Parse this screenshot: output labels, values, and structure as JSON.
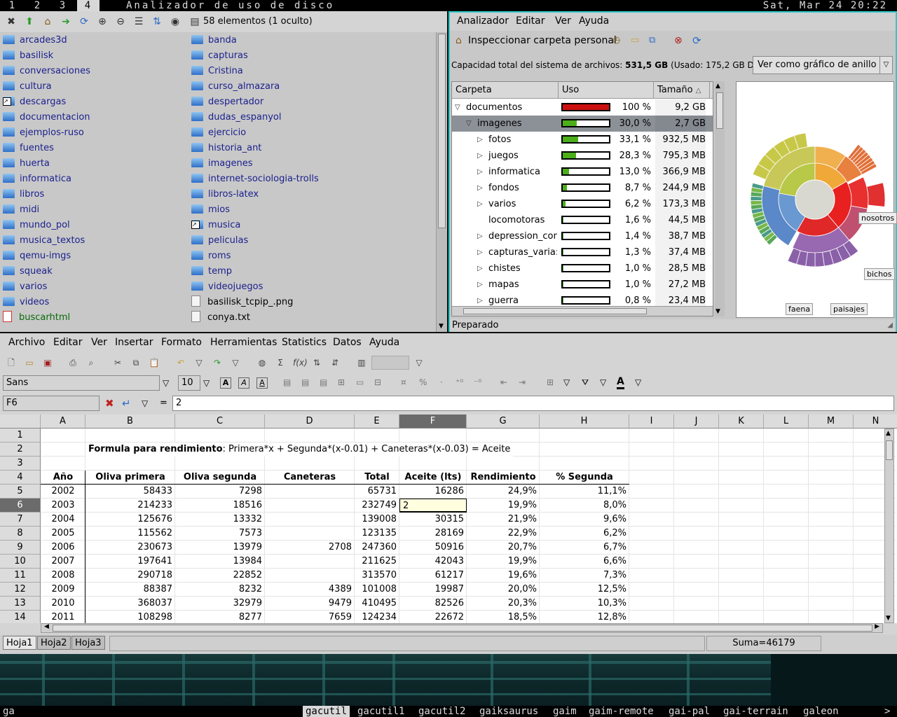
{
  "topbar": {
    "workspaces": [
      "1",
      "2",
      "3",
      "4"
    ],
    "active_workspace": "4",
    "window_title": "Analizador de uso de disco",
    "clock": "Sat, Mar 24 20:22"
  },
  "file_manager": {
    "toolbar_icons": [
      "close-icon",
      "up-icon",
      "home-icon",
      "forward-icon",
      "reload-icon",
      "zoom-in-icon",
      "zoom-out-icon",
      "list-view-icon",
      "sort-icon",
      "show-hidden-icon"
    ],
    "item_count": "58 elementos (1 oculto)",
    "column1": [
      {
        "name": "arcades3d",
        "type": "folder"
      },
      {
        "name": "basilisk",
        "type": "folder"
      },
      {
        "name": "conversaciones",
        "type": "folder"
      },
      {
        "name": "cultura",
        "type": "folder"
      },
      {
        "name": "descargas",
        "type": "link-folder"
      },
      {
        "name": "documentacion",
        "type": "folder"
      },
      {
        "name": "ejemplos-ruso",
        "type": "folder"
      },
      {
        "name": "fuentes",
        "type": "folder"
      },
      {
        "name": "huerta",
        "type": "folder"
      },
      {
        "name": "informatica",
        "type": "folder"
      },
      {
        "name": "libros",
        "type": "folder"
      },
      {
        "name": "midi",
        "type": "folder"
      },
      {
        "name": "mundo_pol",
        "type": "folder"
      },
      {
        "name": "musica_textos",
        "type": "folder"
      },
      {
        "name": "qemu-imgs",
        "type": "folder"
      },
      {
        "name": "squeak",
        "type": "folder"
      },
      {
        "name": "varios",
        "type": "folder"
      },
      {
        "name": "videos",
        "type": "folder"
      },
      {
        "name": "buscarhtml",
        "type": "script"
      }
    ],
    "column2": [
      {
        "name": "banda",
        "type": "folder"
      },
      {
        "name": "capturas",
        "type": "folder"
      },
      {
        "name": "Cristina",
        "type": "folder"
      },
      {
        "name": "curso_almazara",
        "type": "folder"
      },
      {
        "name": "despertador",
        "type": "folder"
      },
      {
        "name": "dudas_espanyol",
        "type": "folder"
      },
      {
        "name": "ejercicio",
        "type": "folder"
      },
      {
        "name": "historia_ant",
        "type": "folder"
      },
      {
        "name": "imagenes",
        "type": "folder"
      },
      {
        "name": "internet-sociologia-trolls",
        "type": "folder"
      },
      {
        "name": "libros-latex",
        "type": "folder"
      },
      {
        "name": "mios",
        "type": "folder"
      },
      {
        "name": "musica",
        "type": "link-folder"
      },
      {
        "name": "peliculas",
        "type": "folder"
      },
      {
        "name": "roms",
        "type": "folder"
      },
      {
        "name": "temp",
        "type": "folder"
      },
      {
        "name": "videojuegos",
        "type": "folder"
      },
      {
        "name": "basilisk_tcpip_.png",
        "type": "file"
      },
      {
        "name": "conya.txt",
        "type": "file"
      }
    ]
  },
  "disk_analyzer": {
    "menu": [
      "Analizador",
      "Editar",
      "Ver",
      "Ayuda"
    ],
    "toolbar_label": "Inspeccionar carpeta personal",
    "capacity_text": "Capacidad total del sistema de archivos:",
    "capacity_value": "531,5 GB",
    "capacity_usage": "(Usado: 175,2 GB Dispon",
    "view_mode": "Ver como gráfico de anillo",
    "columns": [
      "Carpeta",
      "Uso",
      "Tamaño"
    ],
    "rows": [
      {
        "name": "documentos",
        "percent": "100 %",
        "size": "9,2 GB",
        "level": 0,
        "expanded": true,
        "fill": 1.0,
        "color": "#cc1010"
      },
      {
        "name": "imagenes",
        "percent": "30,0 %",
        "size": "2,7 GB",
        "level": 1,
        "expanded": true,
        "fill": 0.3,
        "color": "#4caf1a",
        "selected": true
      },
      {
        "name": "fotos",
        "percent": "33,1 %",
        "size": "932,5 MB",
        "level": 2,
        "fill": 0.331,
        "color": "#4caf1a"
      },
      {
        "name": "juegos",
        "percent": "28,3 %",
        "size": "795,3 MB",
        "level": 2,
        "fill": 0.283,
        "color": "#4caf1a"
      },
      {
        "name": "informatica",
        "percent": "13,0 %",
        "size": "366,9 MB",
        "level": 2,
        "fill": 0.13,
        "color": "#4caf1a"
      },
      {
        "name": "fondos",
        "percent": "8,7 %",
        "size": "244,9 MB",
        "level": 2,
        "fill": 0.087,
        "color": "#4caf1a"
      },
      {
        "name": "varios",
        "percent": "6,2 %",
        "size": "173,3 MB",
        "level": 2,
        "fill": 0.062,
        "color": "#4caf1a"
      },
      {
        "name": "locomotoras",
        "percent": "1,6 %",
        "size": "44,5 MB",
        "level": 2,
        "leaf": true,
        "fill": 0.016,
        "color": "#4caf1a"
      },
      {
        "name": "depression_con",
        "percent": "1,4 %",
        "size": "38,7 MB",
        "level": 2,
        "fill": 0.014,
        "color": "#4caf1a"
      },
      {
        "name": "capturas_varia:",
        "percent": "1,3 %",
        "size": "37,4 MB",
        "level": 2,
        "fill": 0.013,
        "color": "#4caf1a"
      },
      {
        "name": "chistes",
        "percent": "1,0 %",
        "size": "28,5 MB",
        "level": 2,
        "fill": 0.01,
        "color": "#4caf1a"
      },
      {
        "name": "mapas",
        "percent": "1,0 %",
        "size": "27,2 MB",
        "level": 2,
        "fill": 0.01,
        "color": "#4caf1a"
      },
      {
        "name": "guerra",
        "percent": "0,8 %",
        "size": "23,4 MB",
        "level": 2,
        "fill": 0.008,
        "color": "#4caf1a"
      }
    ],
    "ring_labels": [
      "nosotros",
      "bichos",
      "faena",
      "paisajes"
    ],
    "status": "Preparado"
  },
  "spreadsheet": {
    "menu": [
      "Archivo",
      "Editar",
      "Ver",
      "Insertar",
      "Formato",
      "Herramientas",
      "Statistics",
      "Datos",
      "Ayuda"
    ],
    "font_name": "Sans",
    "font_size": "10",
    "cell_ref": "F6",
    "formula_value": "2",
    "columns": [
      "A",
      "B",
      "C",
      "D",
      "E",
      "F",
      "G",
      "H",
      "I",
      "J",
      "K",
      "L",
      "M",
      "N"
    ],
    "active_column": "F",
    "row_numbers": [
      "1",
      "2",
      "3",
      "4",
      "5",
      "6",
      "7",
      "8",
      "9",
      "10",
      "11",
      "12",
      "13",
      "14"
    ],
    "active_row": "6",
    "formula_label": "Formula para rendimiento",
    "formula_text": ": Primera*x + Segunda*(x-0.01) + Caneteras*(x-0.03) = Aceite",
    "headers": [
      "Año",
      "Oliva primera",
      "Oliva segunda",
      "Caneteras",
      "Total",
      "Aceite (lts)",
      "Rendimiento",
      "% Segunda"
    ],
    "rows": [
      [
        "2002",
        "58433",
        "7298",
        "",
        "65731",
        "16286",
        "24,9%",
        "11,1%"
      ],
      [
        "2003",
        "214233",
        "18516",
        "",
        "232749",
        "2",
        "19,9%",
        "8,0%"
      ],
      [
        "2004",
        "125676",
        "13332",
        "",
        "139008",
        "30315",
        "21,9%",
        "9,6%"
      ],
      [
        "2005",
        "115562",
        "7573",
        "",
        "123135",
        "28169",
        "22,9%",
        "6,2%"
      ],
      [
        "2006",
        "230673",
        "13979",
        "2708",
        "247360",
        "50916",
        "20,7%",
        "6,7%"
      ],
      [
        "2007",
        "197641",
        "13984",
        "",
        "211625",
        "42043",
        "19,9%",
        "6,6%"
      ],
      [
        "2008",
        "290718",
        "22852",
        "",
        "313570",
        "61217",
        "19,6%",
        "7,3%"
      ],
      [
        "2009",
        "88387",
        "8232",
        "4389",
        "101008",
        "19987",
        "20,0%",
        "12,5%"
      ],
      [
        "2010",
        "368037",
        "32979",
        "9479",
        "410495",
        "82526",
        "20,3%",
        "10,3%"
      ],
      [
        "2011",
        "108298",
        "8277",
        "7659",
        "124234",
        "22672",
        "18,5%",
        "12,8%"
      ]
    ],
    "sheets": [
      "Hoja1",
      "Hoja2",
      "Hoja3"
    ],
    "active_sheet": "Hoja1",
    "sum_text": "Suma=46179"
  },
  "command_bar": {
    "input": "ga",
    "completions": [
      "gacutil",
      "gacutil1",
      "gacutil2",
      "gaiksaurus",
      "gaim",
      "gaim-remote",
      "gai-pal",
      "gai-terrain",
      "galeon"
    ],
    "active_completion": "gacutil",
    "more_indicator": ">"
  }
}
